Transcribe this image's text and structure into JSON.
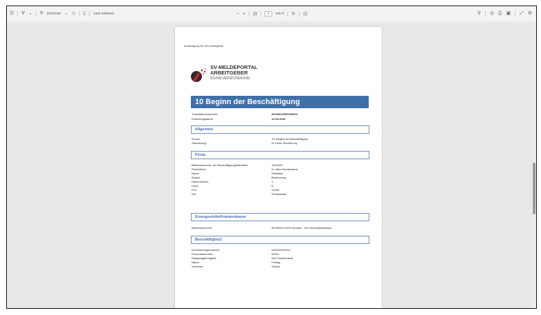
{
  "toolbar": {
    "zeichnen_label": "Zeichnen",
    "laut_vorlesen_label": "Laut vorlesen",
    "zoom_out": "−",
    "zoom_in": "+",
    "page_current": "1",
    "page_of": "von 4"
  },
  "page": {
    "header_text": "Ausfertigung für den Arbeitgeber",
    "logo_line1": "SV-MELDEPORTAL",
    "logo_line2": "ARBEITGEBER",
    "logo_line3": "SOZIALVERSICHERUNG",
    "title": "10 Beginn der Beschäftigung",
    "meta": [
      {
        "label": "Transaktionsnummer:",
        "value": "20230612000000032"
      },
      {
        "label": "Erstellungsdatum:",
        "value": "12.06.2023"
      }
    ],
    "sections": [
      {
        "title": "Allgemein",
        "rows": [
          {
            "label": "Grund:",
            "value": "10: Beginn der Beschäftigung"
          },
          {
            "label": "Stornierung:",
            "value": "N: Keine Stornierung"
          }
        ]
      },
      {
        "title": "Firma",
        "rows": [
          {
            "label": "Betriebsnummer der Beschäftigungsbetriebes:",
            "value": "11111007"
          },
          {
            "label": "Rechtsform:",
            "value": "IV: alles Rumbestand"
          },
          {
            "label": "Name:",
            "value": "Westfalia"
          },
          {
            "label": "Straße:",
            "value": "Blumenweg"
          },
          {
            "label": "Hausnummer:",
            "value": "1"
          },
          {
            "label": "Land:",
            "value": "D"
          },
          {
            "label": "PLZ:",
            "value": "12345"
          },
          {
            "label": "Ort:",
            "value": "Schlaustadt"
          }
        ]
      },
      {
        "title": "Einzugsstelle/Krankenkasse",
        "rows": [
          {
            "label": "Betriebsnummer:",
            "value": "90235319: AOK Nordost - Die Gesundheitskasse"
          }
        ]
      },
      {
        "title": "Beschäftigte(r)",
        "rows": [
          {
            "label": "Versicherungsnummer:",
            "value": "24020200F516"
          },
          {
            "label": "Personalnummer:",
            "value": "00011"
          },
          {
            "label": "Staatsangehörigkeit:",
            "value": "000: Deutschland"
          },
          {
            "label": "Name:",
            "value": "Freitag"
          },
          {
            "label": "Vorname:",
            "value": "Susine"
          }
        ]
      }
    ]
  },
  "colors": {
    "title_bar": "#3f6fa8",
    "section_border": "#6f8fb8",
    "viewer_bg": "#e8e8e8"
  }
}
